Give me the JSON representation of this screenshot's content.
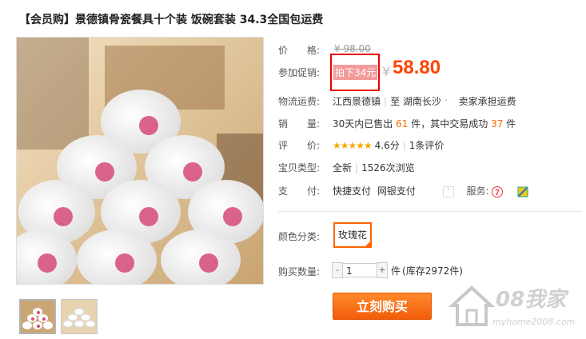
{
  "title": "【会员购】景德镇骨瓷餐具十个装 饭碗套装 34.3全国包运费",
  "price_row": {
    "label": "价　　格:",
    "original": "¥ 98.00"
  },
  "promo_row": {
    "label": "参加促销:",
    "tag": "拍下34元",
    "currency": "¥",
    "price": "58.80"
  },
  "logistics": {
    "label": "物流运费:",
    "from": "江西景德镇",
    "to_prefix": "至",
    "to": "湖南长沙",
    "fee": "卖家承担运费"
  },
  "sales": {
    "label": "销　　量:",
    "text_a": "30天内已售出",
    "sold": "61",
    "text_b": "件，其中交易成功",
    "success": "37",
    "text_c": "件"
  },
  "rating": {
    "label": "评　　价:",
    "stars": "★★★★★",
    "score": "4.6分",
    "reviews": "1条评价"
  },
  "item_type": {
    "label": "宝贝类型:",
    "type": "全新",
    "views": "1526次浏览"
  },
  "payment": {
    "label": "支　　付:",
    "opt1": "快捷支付",
    "opt2": "网银支付",
    "service_label": "服务:"
  },
  "color": {
    "label": "颜色分类:",
    "option": "玫瑰花"
  },
  "quantity": {
    "label": "购买数量:",
    "minus": "-",
    "value": "1",
    "plus": "+",
    "unit": "件",
    "stock": "(库存2972件)"
  },
  "buy_button": "立刻购买",
  "watermark": {
    "brand": "08我家",
    "url": "myhome2008.com"
  },
  "colors": {
    "accent": "#ff4400",
    "promo_border": "#ee0000",
    "buy": "#f25c0c"
  }
}
